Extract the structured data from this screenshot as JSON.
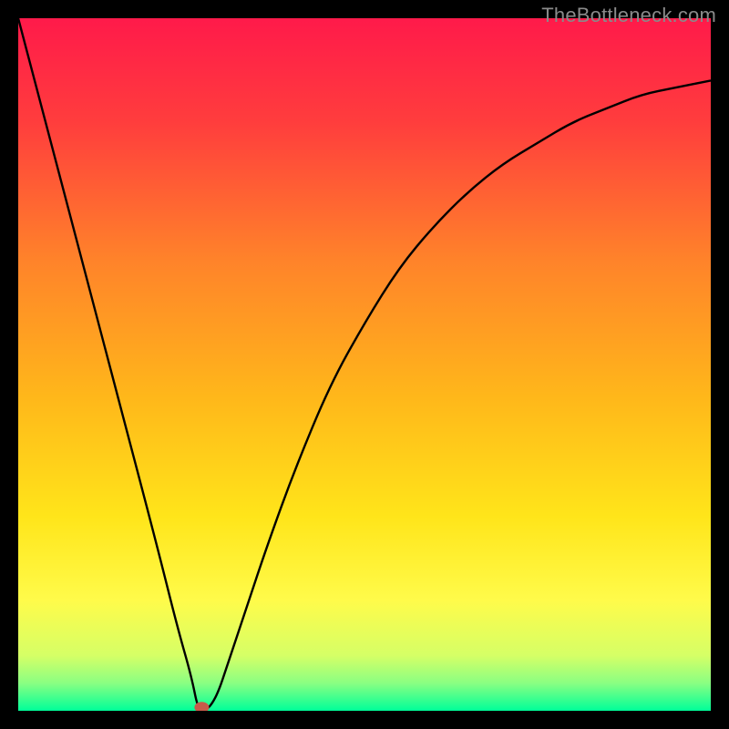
{
  "watermark": "TheBottleneck.com",
  "chart_data": {
    "type": "line",
    "title": "",
    "xlabel": "",
    "ylabel": "",
    "xlim": [
      0,
      100
    ],
    "ylim": [
      0,
      100
    ],
    "x": [
      0,
      5,
      10,
      15,
      20,
      23,
      25,
      26,
      27,
      28,
      29,
      30,
      33,
      36,
      40,
      45,
      50,
      55,
      60,
      65,
      70,
      75,
      80,
      85,
      90,
      95,
      100
    ],
    "values": [
      100,
      81,
      62,
      43,
      24,
      12,
      5,
      0,
      0,
      1,
      3,
      6,
      15,
      24,
      35,
      47,
      56,
      64,
      70,
      75,
      79,
      82,
      85,
      87,
      89,
      90,
      91
    ],
    "marker": {
      "x": 26.5,
      "y": 0.5,
      "color": "#c85a4a"
    },
    "background": {
      "type": "vertical-gradient",
      "stops": [
        {
          "offset": 0.0,
          "color": "#ff1a4a"
        },
        {
          "offset": 0.15,
          "color": "#ff3d3d"
        },
        {
          "offset": 0.35,
          "color": "#ff832a"
        },
        {
          "offset": 0.55,
          "color": "#ffb81a"
        },
        {
          "offset": 0.72,
          "color": "#ffe51a"
        },
        {
          "offset": 0.84,
          "color": "#fffb4a"
        },
        {
          "offset": 0.92,
          "color": "#d6ff66"
        },
        {
          "offset": 0.96,
          "color": "#8aff82"
        },
        {
          "offset": 1.0,
          "color": "#00ff99"
        }
      ]
    }
  }
}
